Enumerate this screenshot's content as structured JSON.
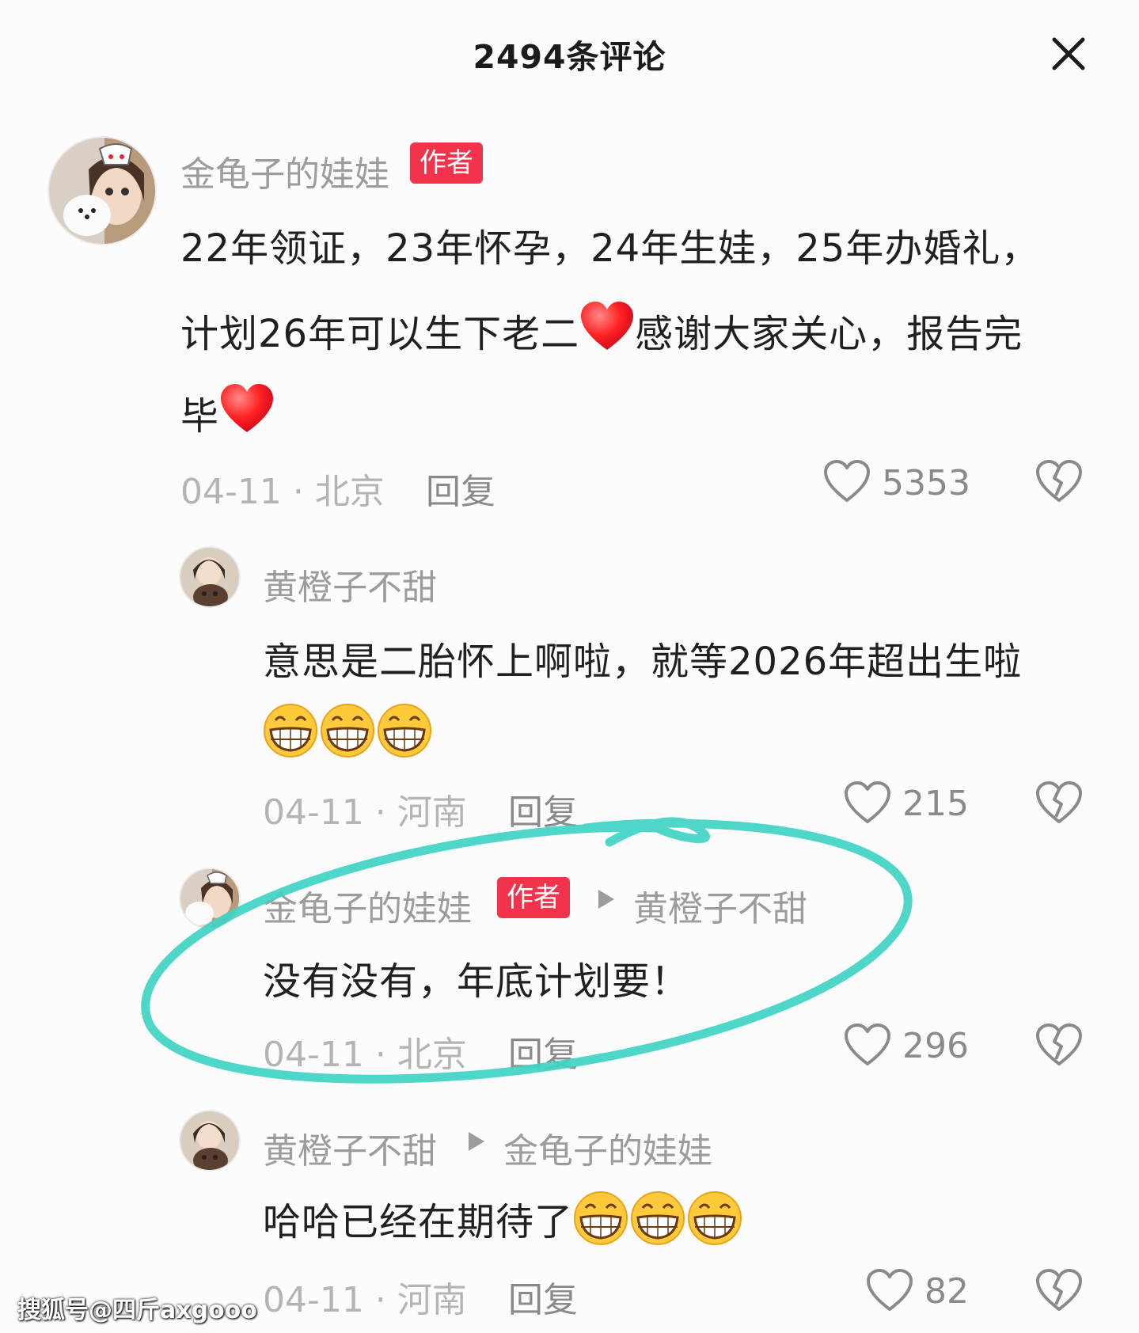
{
  "header": {
    "title": "2494条评论"
  },
  "comments": [
    {
      "user": "金龟子的娃娃",
      "badge": "作者",
      "lines": [
        "22年领证，23年怀孕，24年生娃，25年办婚礼，",
        "计划26年可以生下老二",
        "感谢大家关心，报告完",
        "毕"
      ],
      "date_loc": "04-11 · 北京",
      "reply": "回复",
      "likes": "5353"
    },
    {
      "user": "黄橙子不甜",
      "lines": [
        "意思是二胎怀上啊啦，就等2026年超出生啦"
      ],
      "date_loc": "04-11 · 河南",
      "reply": "回复",
      "likes": "215"
    },
    {
      "user": "金龟子的娃娃",
      "badge": "作者",
      "reply_to": "黄橙子不甜",
      "lines": [
        "没有没有，年底计划要！"
      ],
      "date_loc": "04-11 · 北京",
      "reply": "回复",
      "likes": "296"
    },
    {
      "user": "黄橙子不甜",
      "reply_to": "金龟子的娃娃",
      "lines": [
        "哈哈已经在期待了"
      ],
      "date_loc": "04-11 · 河南",
      "reply": "回复",
      "likes": "82"
    }
  ],
  "watermark": "搜狐号@四斤axgooo",
  "colors": {
    "badge": "#f2334c",
    "highlight_circle": "#3fd4c4",
    "muted_text": "#9c9c9c"
  },
  "icons": [
    "close-icon",
    "heart-outline-icon",
    "broken-heart-icon",
    "red-heart-emoji",
    "grinning-emoji",
    "reply-arrow-icon"
  ]
}
